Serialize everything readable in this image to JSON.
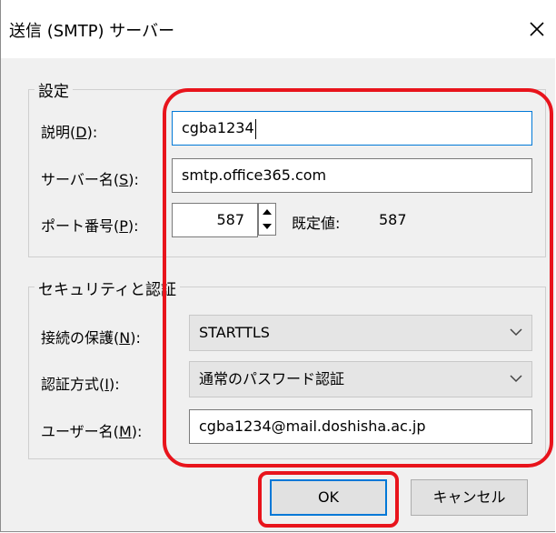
{
  "dialog": {
    "title": "送信 (SMTP) サーバー",
    "close_glyph": "✕"
  },
  "settings": {
    "group_label": "設定",
    "description": {
      "label_pre": "説明(",
      "label_key": "D",
      "label_post": "):",
      "value": "cgba1234"
    },
    "server": {
      "label_pre": "サーバー名(",
      "label_key": "S",
      "label_post": "):",
      "value": "smtp.office365.com"
    },
    "port": {
      "label_pre": "ポート番号(",
      "label_key": "P",
      "label_post": "):",
      "value": "587",
      "default_label": "既定値:",
      "default_value": "587"
    }
  },
  "security": {
    "group_label": "セキュリティと認証",
    "connection": {
      "label_pre": "接続の保護(",
      "label_key": "N",
      "label_post": "):",
      "value": "STARTTLS"
    },
    "auth": {
      "label_pre": "認証方式(",
      "label_key": "I",
      "label_post": "):",
      "value": "通常のパスワード認証"
    },
    "username": {
      "label_pre": "ユーザー名(",
      "label_key": "M",
      "label_post": "):",
      "value": "cgba1234@mail.doshisha.ac.jp"
    }
  },
  "buttons": {
    "ok": "OK",
    "cancel": "キャンセル"
  },
  "colors": {
    "highlight_red": "#e8141c",
    "focus_blue": "#0078d7",
    "dialog_bg": "#f0f0f0"
  }
}
